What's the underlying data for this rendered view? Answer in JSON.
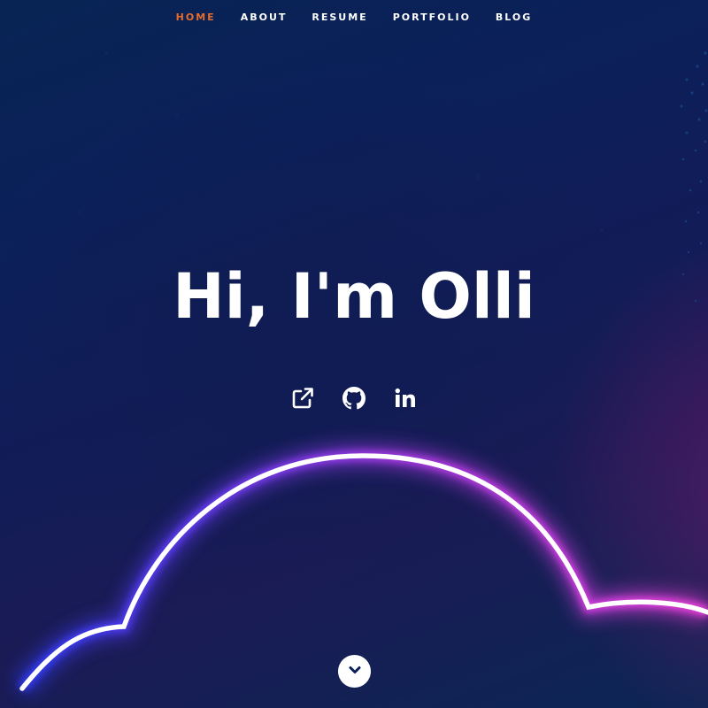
{
  "nav": {
    "items": [
      {
        "label": "HOME",
        "active": true
      },
      {
        "label": "ABOUT",
        "active": false
      },
      {
        "label": "RESUME",
        "active": false
      },
      {
        "label": "PORTFOLIO",
        "active": false
      },
      {
        "label": "BLOG",
        "active": false
      }
    ],
    "active_color": "#e56b2b",
    "text_color": "#ffffff"
  },
  "hero": {
    "title": "Hi, I'm Olli"
  },
  "social": {
    "icons": [
      "external-link-icon",
      "github-icon",
      "linkedin-icon"
    ]
  },
  "scroll": {
    "icon": "chevron-down-icon"
  },
  "colors": {
    "background": "#0b2059",
    "glow_blue": "#3b3bff",
    "glow_magenta": "#ff3fe0"
  }
}
